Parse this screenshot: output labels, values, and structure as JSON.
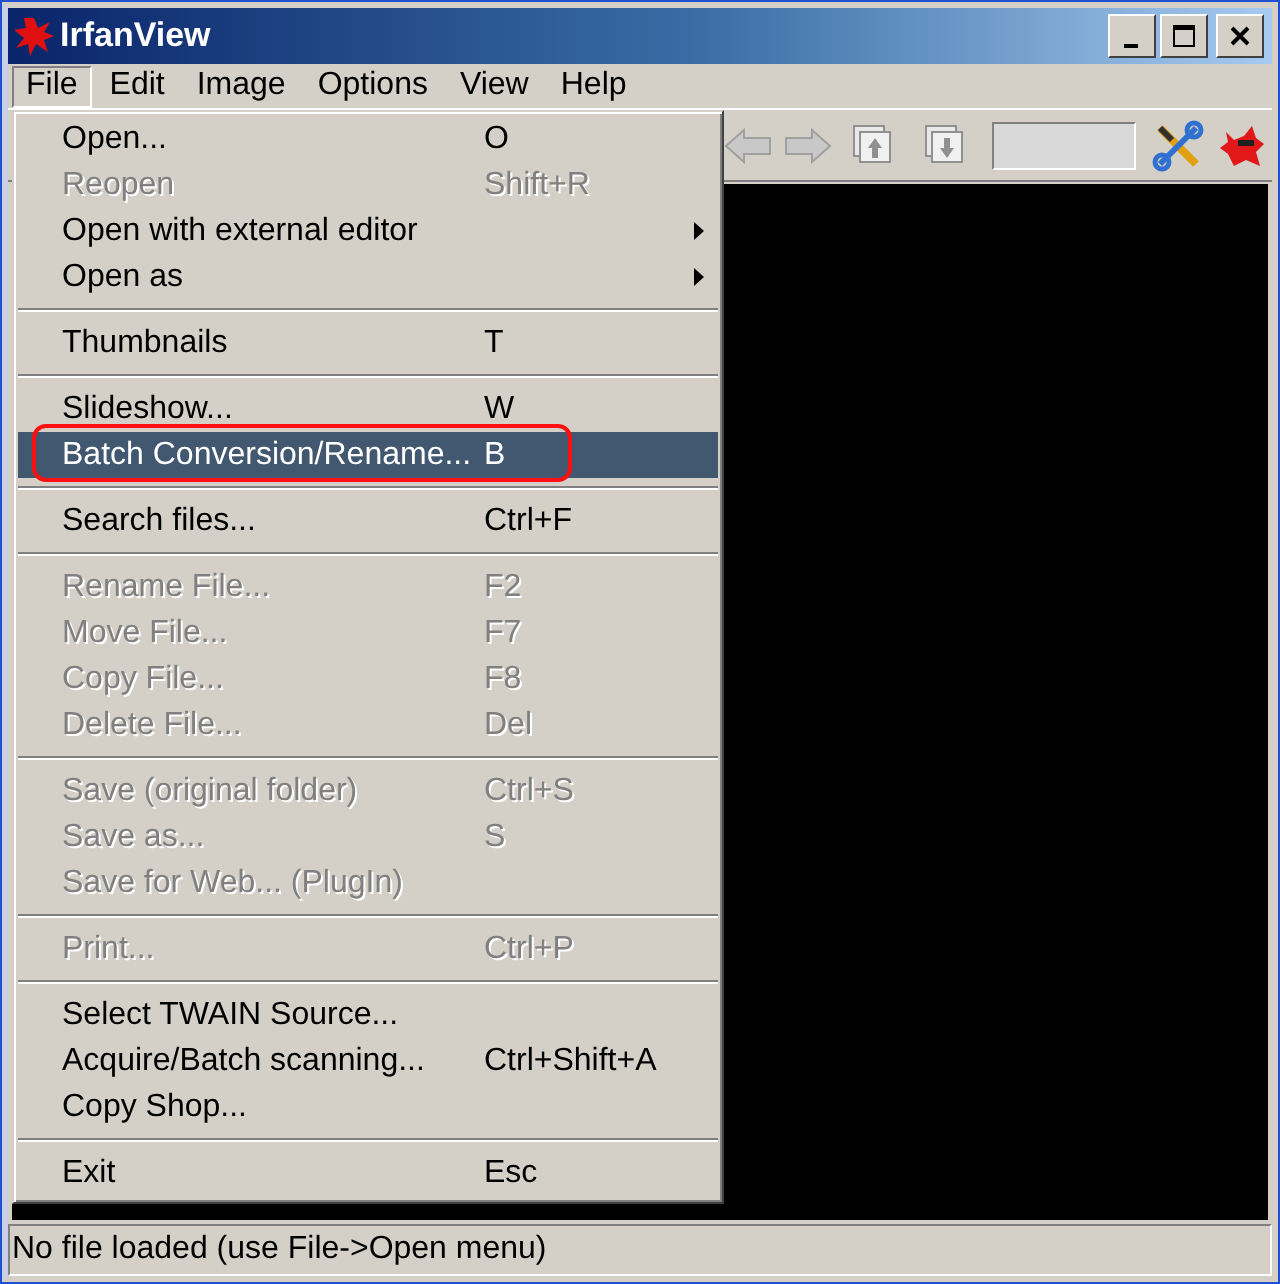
{
  "window": {
    "title": "IrfanView"
  },
  "menubar": [
    {
      "label": "File",
      "selected": true
    },
    {
      "label": "Edit",
      "selected": false
    },
    {
      "label": "Image",
      "selected": false
    },
    {
      "label": "Options",
      "selected": false
    },
    {
      "label": "View",
      "selected": false
    },
    {
      "label": "Help",
      "selected": false
    }
  ],
  "file_menu": [
    {
      "kind": "item",
      "label": "Open...",
      "shortcut": "O",
      "disabled": false,
      "selected": false
    },
    {
      "kind": "item",
      "label": "Reopen",
      "shortcut": "Shift+R",
      "disabled": true,
      "selected": false
    },
    {
      "kind": "submenu",
      "label": "Open with external editor",
      "disabled": false,
      "selected": false
    },
    {
      "kind": "submenu",
      "label": "Open as",
      "disabled": false,
      "selected": false
    },
    {
      "kind": "separator"
    },
    {
      "kind": "item",
      "label": "Thumbnails",
      "shortcut": "T",
      "disabled": false,
      "selected": false
    },
    {
      "kind": "separator"
    },
    {
      "kind": "item",
      "label": "Slideshow...",
      "shortcut": "W",
      "disabled": false,
      "selected": false
    },
    {
      "kind": "item",
      "label": "Batch Conversion/Rename...",
      "shortcut": "B",
      "disabled": false,
      "selected": true,
      "circled": true
    },
    {
      "kind": "separator"
    },
    {
      "kind": "item",
      "label": "Search files...",
      "shortcut": "Ctrl+F",
      "disabled": false,
      "selected": false
    },
    {
      "kind": "separator"
    },
    {
      "kind": "item",
      "label": "Rename File...",
      "shortcut": "F2",
      "disabled": true,
      "selected": false
    },
    {
      "kind": "item",
      "label": "Move File...",
      "shortcut": "F7",
      "disabled": true,
      "selected": false
    },
    {
      "kind": "item",
      "label": "Copy File...",
      "shortcut": "F8",
      "disabled": true,
      "selected": false
    },
    {
      "kind": "item",
      "label": "Delete File...",
      "shortcut": "Del",
      "disabled": true,
      "selected": false
    },
    {
      "kind": "separator"
    },
    {
      "kind": "item",
      "label": "Save (original folder)",
      "shortcut": "Ctrl+S",
      "disabled": true,
      "selected": false
    },
    {
      "kind": "item",
      "label": "Save as...",
      "shortcut": "S",
      "disabled": true,
      "selected": false
    },
    {
      "kind": "item",
      "label": "Save for Web... (PlugIn)",
      "disabled": true,
      "selected": false
    },
    {
      "kind": "separator"
    },
    {
      "kind": "item",
      "label": "Print...",
      "shortcut": "Ctrl+P",
      "disabled": true,
      "selected": false
    },
    {
      "kind": "separator"
    },
    {
      "kind": "item",
      "label": "Select TWAIN Source...",
      "disabled": false,
      "selected": false
    },
    {
      "kind": "item",
      "label": "Acquire/Batch scanning...",
      "shortcut": "Ctrl+Shift+A",
      "disabled": false,
      "selected": false
    },
    {
      "kind": "item",
      "label": "Copy Shop...",
      "disabled": false,
      "selected": false
    },
    {
      "kind": "separator"
    },
    {
      "kind": "item",
      "label": "Exit",
      "shortcut": "Esc",
      "disabled": false,
      "selected": false
    }
  ],
  "status_bar": {
    "text": "No file loaded (use File->Open menu)"
  }
}
